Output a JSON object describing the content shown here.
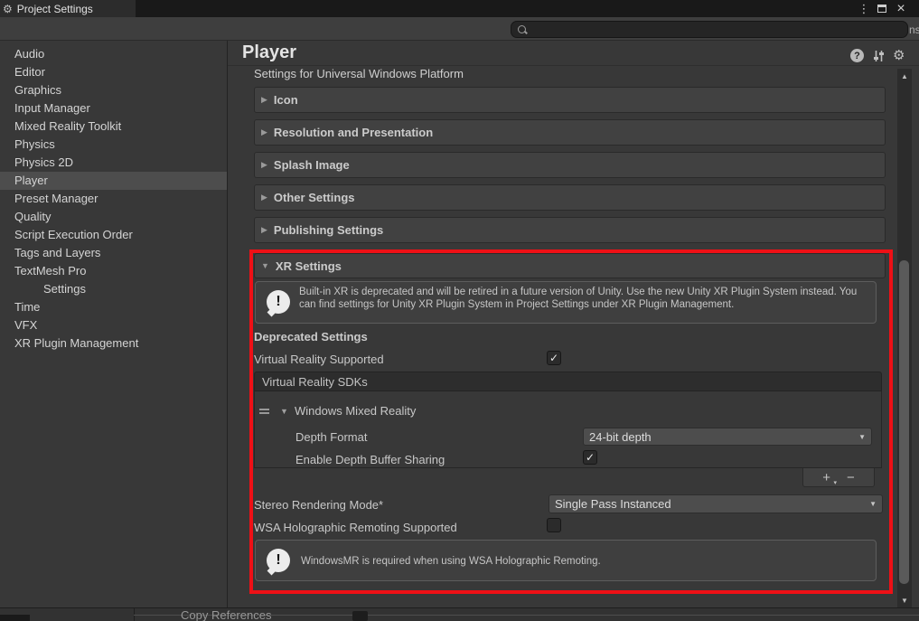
{
  "window": {
    "title": "Project Settings"
  },
  "icons": {
    "gear": "⚙",
    "window_menu": "⋮",
    "window_close": "×",
    "foldout_collapsed": "▶",
    "foldout_expanded": "▼",
    "dropdown_arrow": "▼",
    "scroll_up": "▲",
    "scroll_down": "▼",
    "check": "✓",
    "add": "+",
    "add_more": "▾",
    "remove": "−",
    "help": "?",
    "warning": "!"
  },
  "toolbar": {
    "search_value": "",
    "clipped_text": "ns"
  },
  "sidebar": {
    "items": [
      {
        "label": "Audio"
      },
      {
        "label": "Editor"
      },
      {
        "label": "Graphics"
      },
      {
        "label": "Input Manager"
      },
      {
        "label": "Mixed Reality Toolkit"
      },
      {
        "label": "Physics"
      },
      {
        "label": "Physics 2D"
      },
      {
        "label": "Player",
        "selected": true
      },
      {
        "label": "Preset Manager"
      },
      {
        "label": "Quality"
      },
      {
        "label": "Script Execution Order"
      },
      {
        "label": "Tags and Layers"
      },
      {
        "label": "TextMesh Pro"
      },
      {
        "label": "Settings",
        "indented": true
      },
      {
        "label": "Time"
      },
      {
        "label": "VFX"
      },
      {
        "label": "XR Plugin Management"
      }
    ]
  },
  "main": {
    "title": "Player",
    "platform_caption": "Settings for Universal Windows Platform",
    "sections": [
      {
        "label": "Icon",
        "expanded": false
      },
      {
        "label": "Resolution and Presentation",
        "expanded": false
      },
      {
        "label": "Splash Image",
        "expanded": false
      },
      {
        "label": "Other Settings",
        "expanded": false
      },
      {
        "label": "Publishing Settings",
        "expanded": false
      }
    ],
    "xr_settings": {
      "label": "XR Settings",
      "expanded": true,
      "highlighted": true,
      "deprecation_notice": "Built-in XR is deprecated and will be retired in a future version of Unity. Use the new Unity XR Plugin System instead. You can find settings for Unity XR Plugin System in Project Settings under XR Plugin Management.",
      "group_header": "Deprecated Settings",
      "virtual_reality_supported": {
        "label": "Virtual Reality Supported",
        "checked": true
      },
      "sdk_list": {
        "header": "Virtual Reality SDKs",
        "item": {
          "label": "Windows Mixed Reality",
          "expanded": true,
          "depth_format": {
            "label": "Depth Format",
            "value": "24-bit depth"
          },
          "enable_depth_buffer_sharing": {
            "label": "Enable Depth Buffer Sharing",
            "checked": true
          }
        }
      },
      "stereo_rendering_mode": {
        "label": "Stereo Rendering Mode*",
        "value": "Single Pass Instanced"
      },
      "wsa_holographic_remoting": {
        "label": "WSA Holographic Remoting Supported",
        "checked": false
      },
      "wsa_warning": "WindowsMR is required when using WSA Holographic Remoting."
    }
  },
  "background_window": {
    "menu_item": "Copy References"
  },
  "colors": {
    "highlight_border": "#ee1016",
    "selection": "#4d4d4d",
    "panel_bg": "#383838",
    "titlebar_bg": "#191919"
  }
}
